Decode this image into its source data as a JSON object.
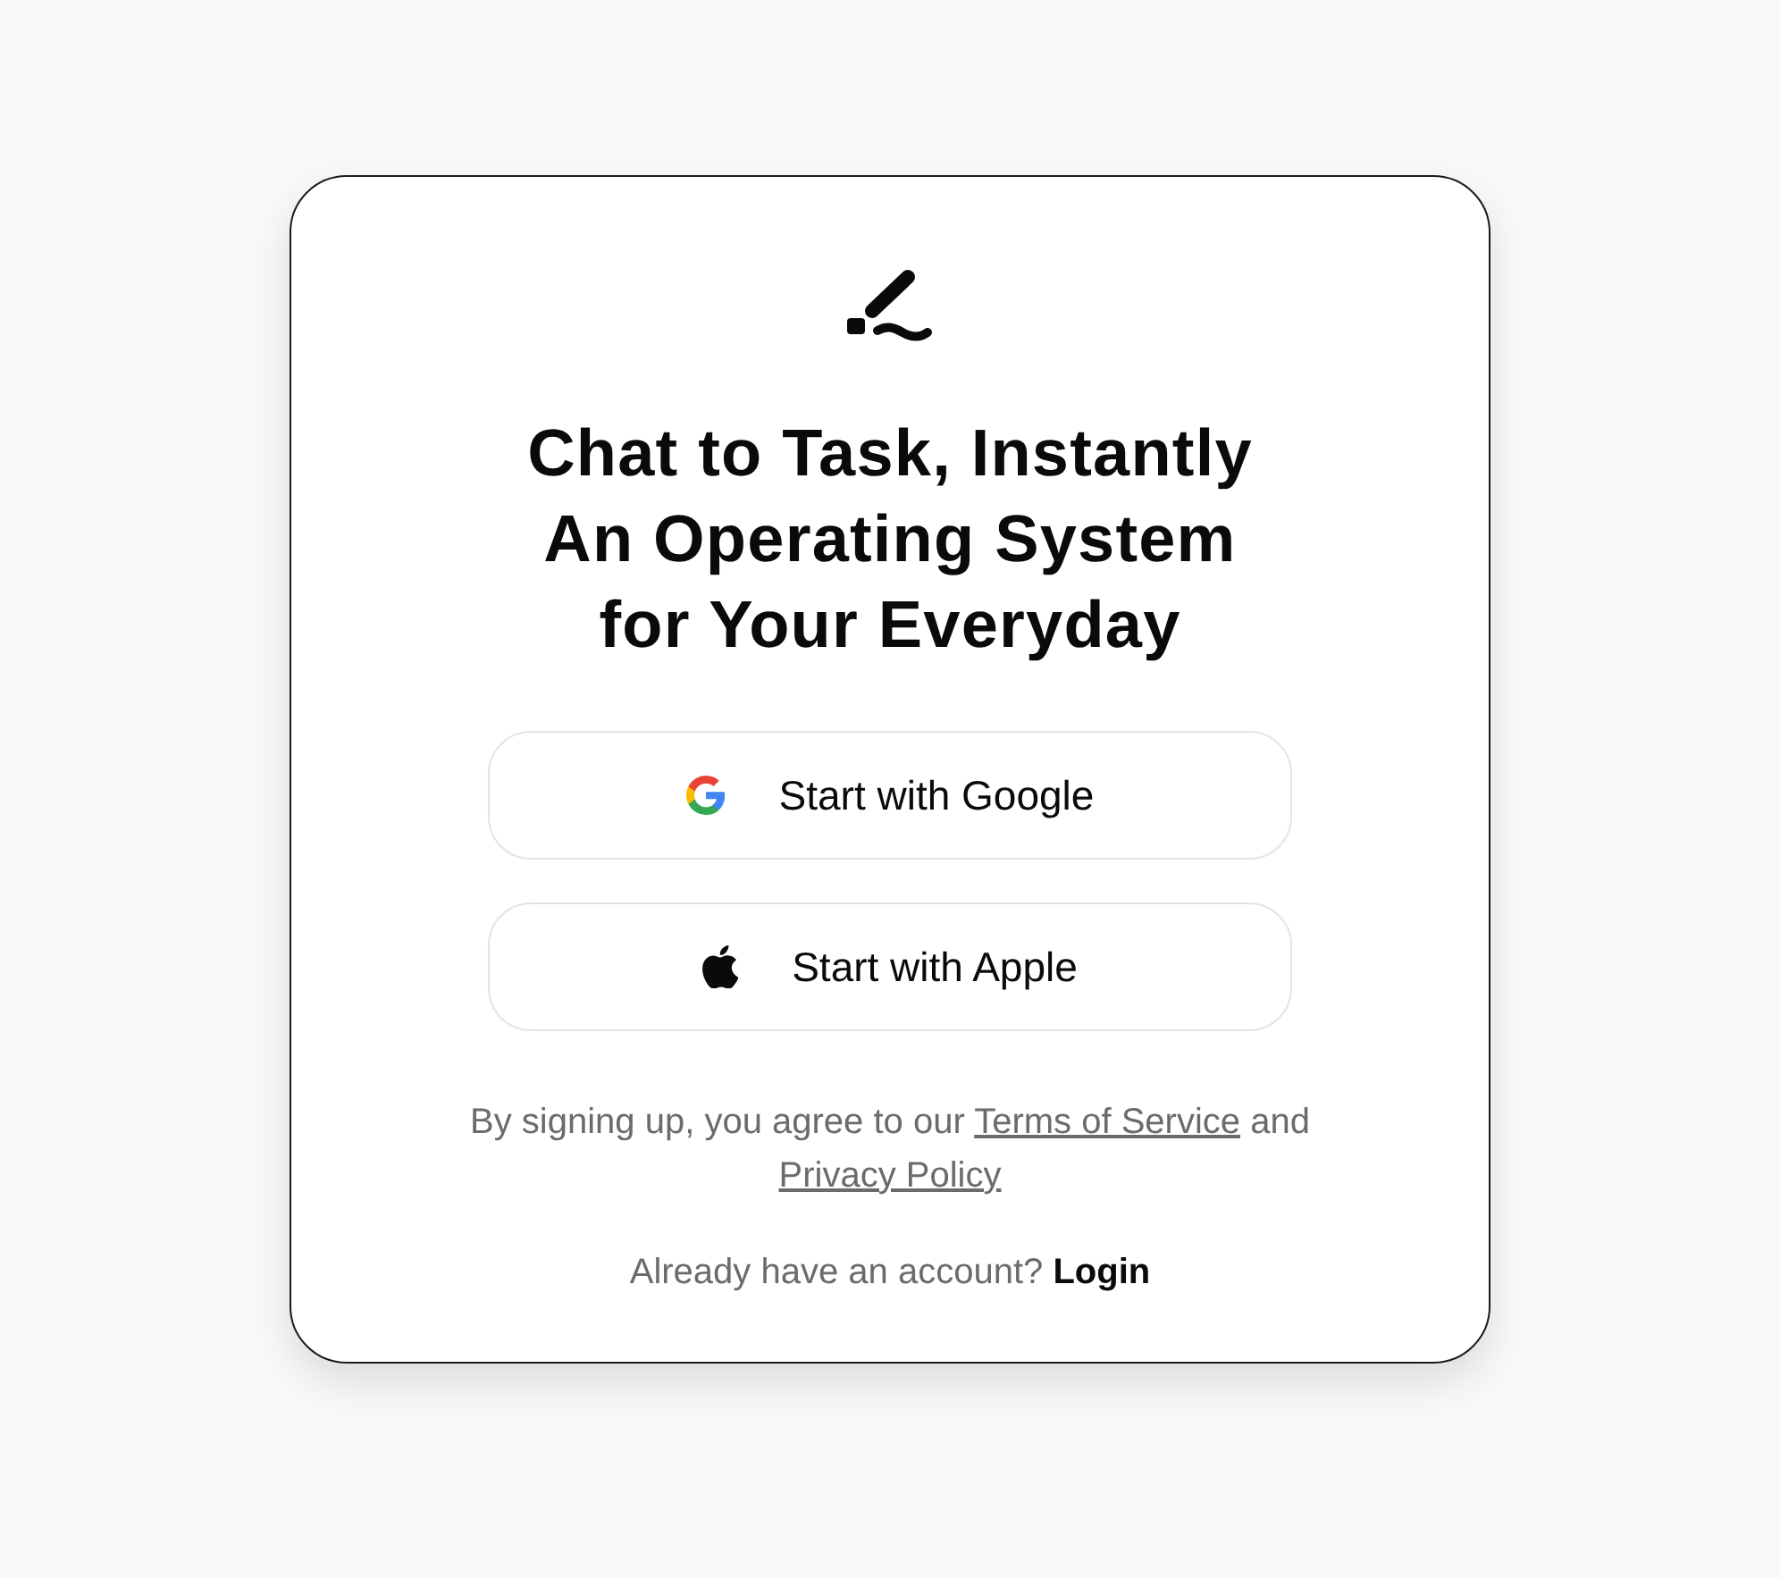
{
  "headline": [
    "Chat to Task, Instantly",
    "An Operating System",
    "for Your Everyday"
  ],
  "sign_in_buttons": [
    {
      "kind": "google",
      "label": "Start with Google"
    },
    {
      "kind": "apple",
      "label": "Start with Apple"
    }
  ],
  "legal_notice": [
    {
      "kind": "text",
      "text": "By signing up, you agree to our"
    },
    {
      "kind": "link",
      "text": "Terms of Service"
    },
    {
      "kind": "text",
      "text": "and"
    },
    {
      "kind": "link",
      "text": "Privacy Policy"
    }
  ],
  "login_prompt": {
    "text": "Already have an account?",
    "link": "Login"
  }
}
